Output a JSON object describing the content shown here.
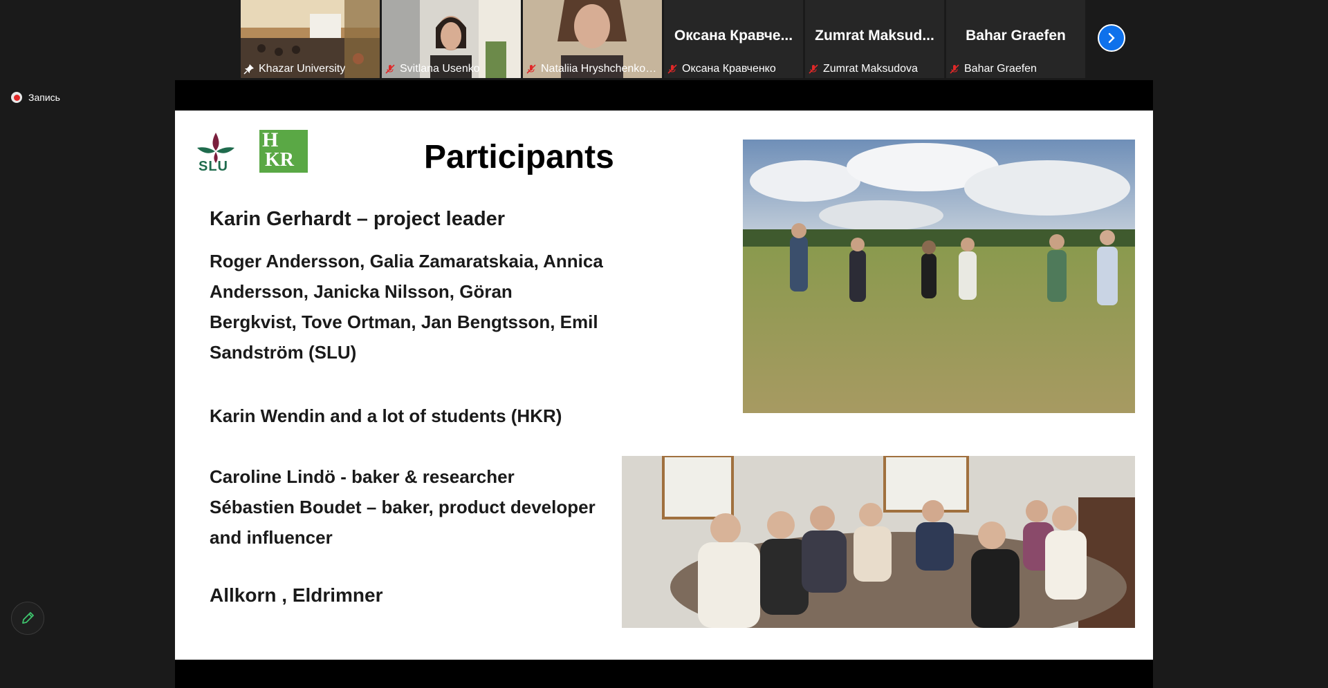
{
  "participants": [
    {
      "label": "Khazar University",
      "big_name": "",
      "mic": "pin"
    },
    {
      "label": "Svitlana Usenko",
      "big_name": "",
      "mic": "muted"
    },
    {
      "label": "Nataliia Hryshchenko, ...",
      "big_name": "",
      "mic": "muted"
    },
    {
      "label": "Оксана Кравченко",
      "big_name": "Оксана  Кравче...",
      "mic": "muted"
    },
    {
      "label": "Zumrat Maksudova",
      "big_name": "Zumrat  Maksud...",
      "mic": "muted"
    },
    {
      "label": "Bahar Graefen",
      "big_name": "Bahar Graefen",
      "mic": "muted"
    }
  ],
  "recording": {
    "label": "Запись"
  },
  "slide": {
    "title": "Participants",
    "slu_logo_text": "SLU",
    "hkr_logo_text": "HKR",
    "lead_line": "Karin Gerhardt – project leader",
    "para1": [
      "Roger Andersson, Galia Zamaratskaia, Annica",
      "Andersson, Janicka Nilsson, Göran",
      "Bergkvist, Tove Ortman, Jan Bengtsson, Emil",
      "Sandström (SLU)"
    ],
    "para2": "Karin Wendin and a lot of students (HKR)",
    "para3": [
      "Caroline Lindö  -  baker  & researcher",
      "Sébastien Boudet – baker, product developer",
      "and influencer"
    ],
    "para4": "Allkorn , Eldrimner"
  },
  "colors": {
    "accent": "#0e71eb",
    "muted_red": "#e02828",
    "slu_green": "#1f6b4d",
    "hkr_green": "#5aa845"
  },
  "icons": {
    "next": "chevron-right-icon",
    "annotate": "pencil-icon",
    "muted": "mic-muted-icon",
    "pin": "pin-icon"
  }
}
